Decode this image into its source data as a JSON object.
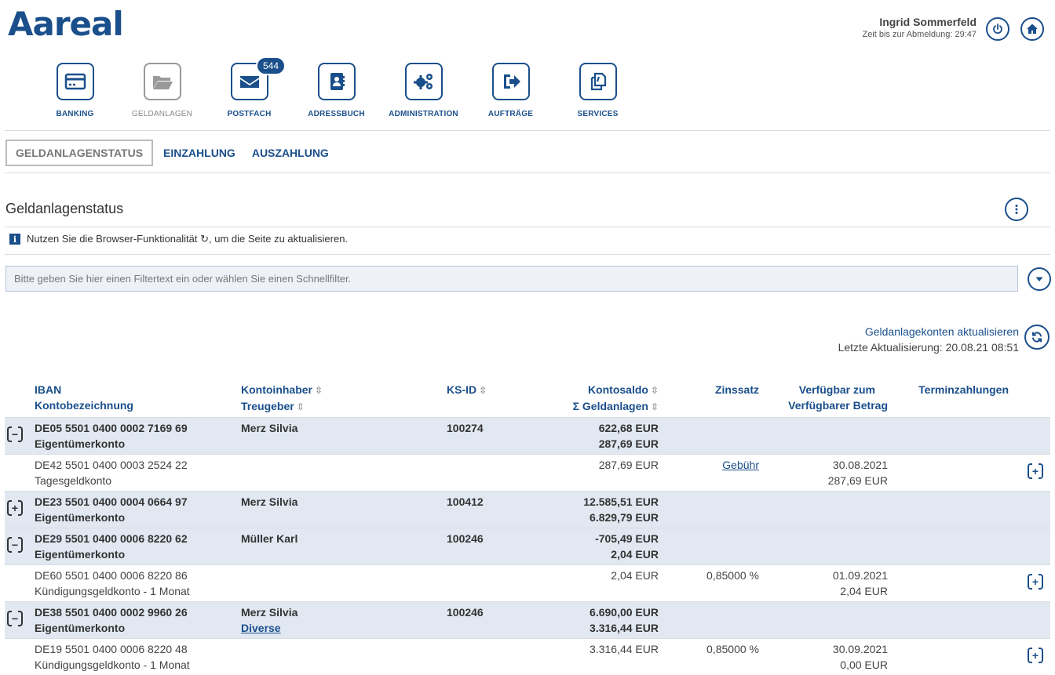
{
  "brand": {
    "logo_text": "Aareal",
    "color": "#1a4f8b"
  },
  "user": {
    "name": "Ingrid Sommerfeld",
    "timer": "Zeit bis zur Abmeldung: 29:47"
  },
  "nav": [
    {
      "label": "BANKING",
      "icon": "credit-card-icon"
    },
    {
      "label": "GELDANLAGEN",
      "icon": "folder-icon",
      "inactive": true
    },
    {
      "label": "POSTFACH",
      "icon": "envelope-icon",
      "badge": "544"
    },
    {
      "label": "ADRESSBUCH",
      "icon": "address-book-icon"
    },
    {
      "label": "ADMINISTRATION",
      "icon": "gears-icon"
    },
    {
      "label": "AUFTRÄGE",
      "icon": "sign-out-icon"
    },
    {
      "label": "SERVICES",
      "icon": "copy-icon"
    }
  ],
  "subtabs": [
    "GELDANLAGENSTATUS",
    "EINZAHLUNG",
    "AUSZAHLUNG"
  ],
  "page": {
    "title": "Geldanlagenstatus",
    "info": "Nutzen Sie die Browser-Funktionalität ↻, um die Seite zu aktualisieren.",
    "filter_placeholder": "Bitte geben Sie hier einen Filtertext ein oder wählen Sie einen Schnellfilter.",
    "refresh_link": "Geldanlagekonten aktualisieren",
    "last_update": "Letzte Aktualisierung: 20.08.21 08:51"
  },
  "table": {
    "headers": {
      "iban": "IBAN",
      "kontobezeichnung": "Kontobezeichnung",
      "kontoinhaber": "Kontoinhaber",
      "treugeber": "Treugeber",
      "ksid": "KS-ID",
      "kontosaldo": "Kontosaldo",
      "geldanlagen": "Σ Geldanlagen",
      "zinssatz": "Zinssatz",
      "verfuegbar_zum": "Verfügbar zum",
      "verfuegbarer_betrag": "Verfügbarer Betrag",
      "terminzahlungen": "Terminzahlungen",
      "sort_glyph": "⇳"
    },
    "rows": [
      {
        "type": "group",
        "toggle": "−",
        "iban": "DE05 5501 0400 0002 7169 69",
        "bez": "Eigentümerkonto",
        "inhaber": "Merz Silvia",
        "treugeber": "",
        "ksid": "100274",
        "saldo": "622,68 EUR",
        "geldanlagen": "287,69 EUR"
      },
      {
        "type": "child",
        "iban": "DE42 5501 0400 0003 2524 22",
        "bez": "Tagesgeldkonto",
        "saldo": "287,69 EUR",
        "zins": "Gebühr",
        "zins_link": true,
        "datum": "30.08.2021",
        "betrag": "287,69 EUR"
      },
      {
        "type": "group",
        "toggle": "+",
        "iban": "DE23 5501 0400 0004 0664 97",
        "bez": "Eigentümerkonto",
        "inhaber": "Merz Silvia",
        "treugeber": "",
        "ksid": "100412",
        "saldo": "12.585,51 EUR",
        "geldanlagen": "6.829,79 EUR"
      },
      {
        "type": "group",
        "toggle": "−",
        "iban": "DE29 5501 0400 0006 8220 62",
        "bez": "Eigentümerkonto",
        "inhaber": "Müller Karl",
        "treugeber": "",
        "ksid": "100246",
        "saldo": "-705,49 EUR",
        "geldanlagen": "2,04 EUR"
      },
      {
        "type": "child",
        "iban": "DE60 5501 0400 0006 8220 86",
        "bez": "Kündigungsgeldkonto - 1 Monat",
        "saldo": "2,04 EUR",
        "zins": "0,85000 %",
        "datum": "01.09.2021",
        "betrag": "2,04 EUR"
      },
      {
        "type": "group",
        "toggle": "−",
        "iban": "DE38 5501 0400 0002 9960 26",
        "bez": "Eigentümerkonto",
        "inhaber": "Merz Silvia",
        "treugeber": "Diverse",
        "ksid": "100246",
        "saldo": "6.690,00 EUR",
        "geldanlagen": "3.316,44 EUR"
      },
      {
        "type": "child",
        "iban": "DE19 5501 0400 0006 8220 48",
        "bez": "Kündigungsgeldkonto - 1 Monat",
        "saldo": "3.316,44 EUR",
        "zins": "0,85000 %",
        "datum": "30.09.2021",
        "betrag": "0,00 EUR"
      }
    ]
  }
}
